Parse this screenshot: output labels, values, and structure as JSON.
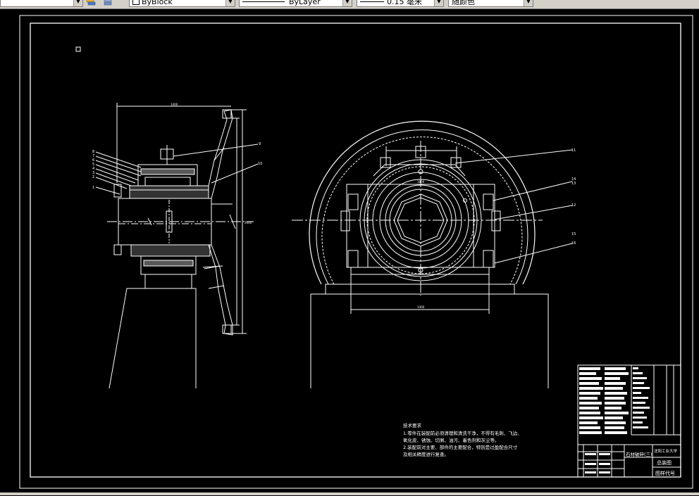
{
  "toolbar": {
    "layer_block_value": "ByBlock",
    "linetype_value": "ByLayer",
    "lineweight_value": "0.15 毫米",
    "plotstyle_value": "随颜色",
    "layer_icon": "layer-stack-icon",
    "dropdown_icon": "chevron-down-icon"
  },
  "drawing": {
    "background": "#000000",
    "line_color": "#ffffff",
    "left_view": {
      "dim_top": "1400",
      "dim_height": "3000",
      "callouts": [
        "8",
        "7",
        "6",
        "5",
        "4",
        "3",
        "2",
        "1",
        "9",
        "10"
      ]
    },
    "right_view": {
      "dim_bearing": "1800",
      "dim_base": "1400",
      "callouts": [
        "11",
        "14",
        "13",
        "12",
        "15",
        "16"
      ]
    },
    "tech_requirements": {
      "heading": "技术要求",
      "line1": "1.零件在装配前必须清理和清洗干净，不得有毛刺、飞边、",
      "line2": "氧化皮、锈蚀、切屑、油污、着色剂和灰尘等。",
      "line3": "2.装配前对主要、部件的主要配合，特别是过盈配合尺寸",
      "line4": "及相关精度进行复查。"
    },
    "title_block": {
      "project": "石材破碎(三)",
      "school": "沈阳工业大学",
      "drawing_name": "总装图",
      "drawing_code": "图样代号"
    }
  }
}
